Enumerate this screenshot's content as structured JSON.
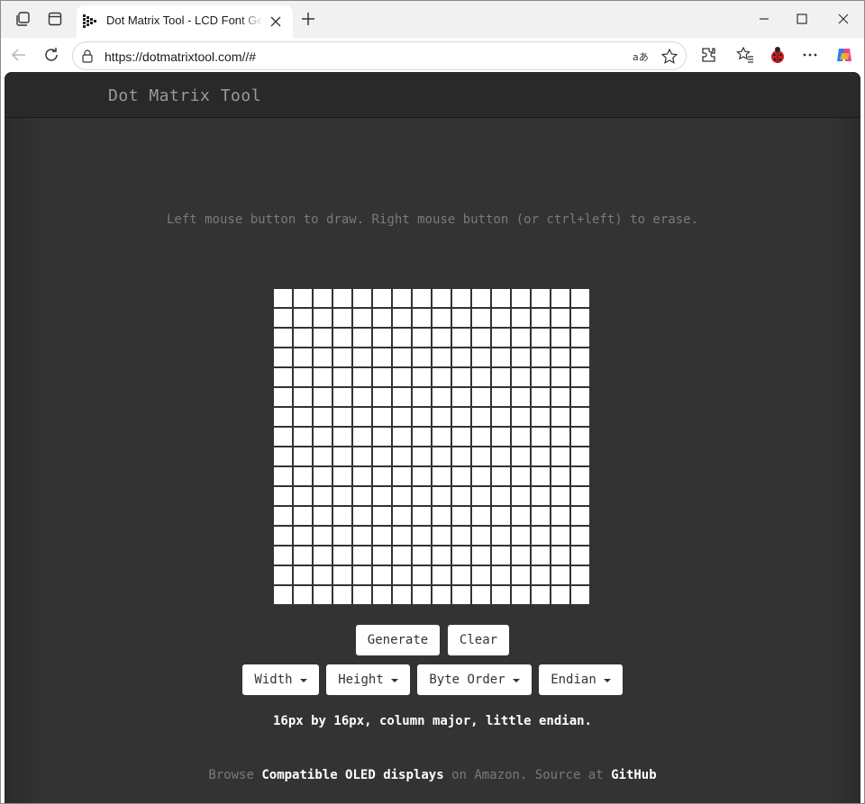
{
  "browser": {
    "tab_title": "Dot Matrix Tool - LCD Font Generator",
    "url": "https://dotmatrixtool.com//#",
    "icons": {
      "workspaces": "workspaces-icon",
      "tab_actions": "tab-actions-icon",
      "favicon": "dot-matrix-favicon",
      "tab_close": "close-icon",
      "new_tab": "plus-icon",
      "minimize": "minimize-icon",
      "maximize": "maximize-icon",
      "close": "close-icon",
      "back": "back-arrow-icon",
      "refresh": "refresh-icon",
      "lock": "lock-icon",
      "read_aloud": "read-aloud-icon",
      "favorite": "star-icon",
      "extensions": "puzzle-icon",
      "favorites": "favorites-icon",
      "ladybug": "ladybug-extension-icon",
      "more": "more-icon",
      "copilot": "copilot-icon"
    }
  },
  "site": {
    "title": "Dot Matrix Tool",
    "instructions": "Left mouse button to draw. Right mouse button (or ctrl+left) to erase."
  },
  "matrix": {
    "width": 16,
    "height": 16,
    "cell_color": "#ffffff",
    "lit_cells": []
  },
  "buttons": {
    "generate": "Generate",
    "clear": "Clear",
    "width": "Width",
    "height": "Height",
    "byte_order": "Byte Order",
    "endian": "Endian"
  },
  "summary": "16px by 16px, column major, little endian.",
  "footer": {
    "browse": "Browse",
    "displays_link": "Compatible OLED displays",
    "on_amazon": "on Amazon. Source at",
    "github_link": "GitHub"
  },
  "colors": {
    "page_background": "#333333",
    "header_background": "#292929",
    "muted_text": "#7a7a7a"
  }
}
